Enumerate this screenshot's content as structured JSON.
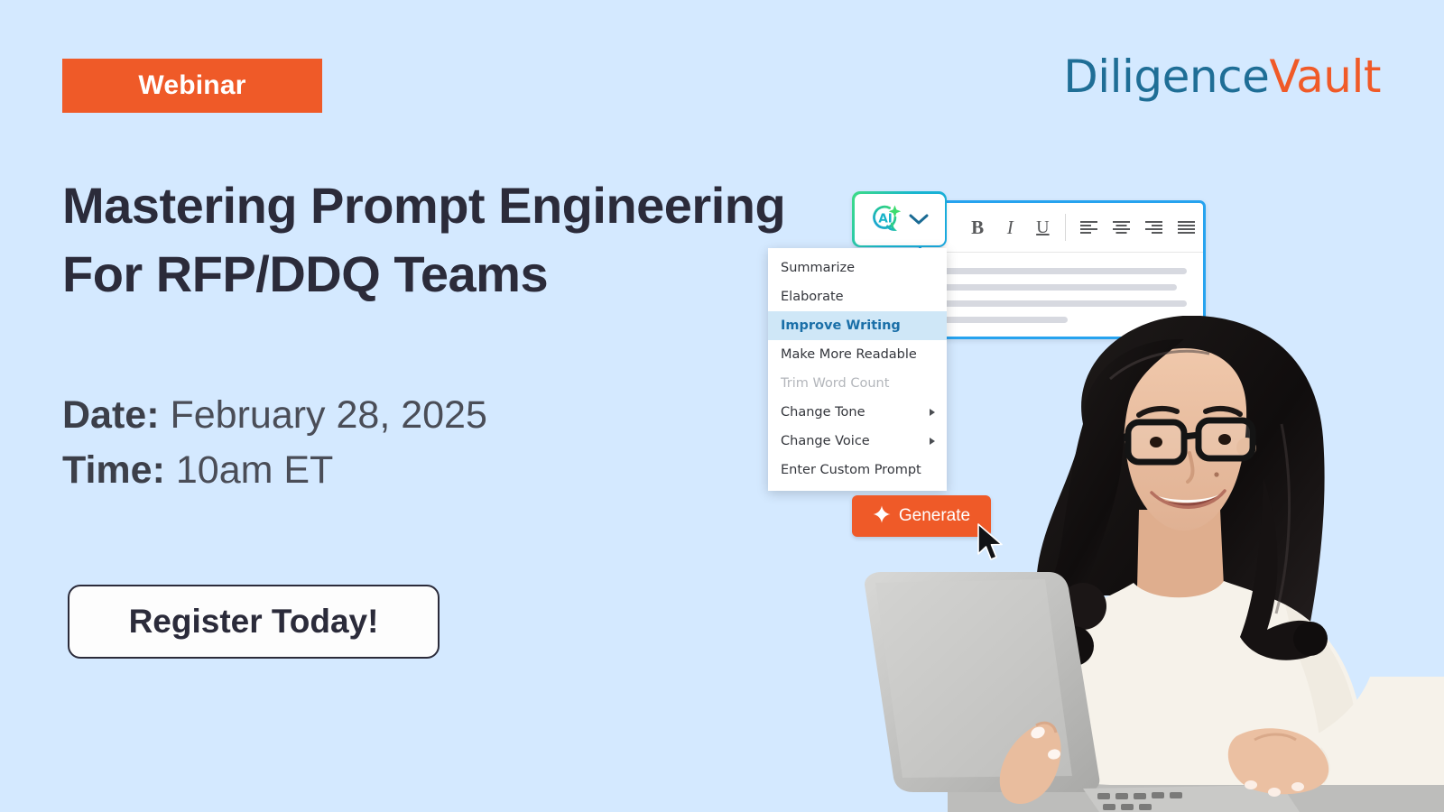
{
  "theme": {
    "background": "#d4e9ff",
    "accent_orange": "#ef5a28",
    "logo_blue": "#1f6e96",
    "logo_orange": "#f05a28",
    "heading_color": "#2b2b3a",
    "editor_border_blue": "#27a3ef",
    "menu_highlight_bg": "#cfe7f7",
    "menu_highlight_text": "#1a6fa8"
  },
  "badge": {
    "label": "Webinar"
  },
  "logo": {
    "part_one": "Diligence",
    "part_two": "Vault"
  },
  "headline": {
    "line1": "Mastering Prompt Engineering",
    "line2": "For RFP/DDQ Teams"
  },
  "details": [
    {
      "label": "Date:",
      "value": "February 28, 2025"
    },
    {
      "label": "Time:",
      "value": "10am ET"
    }
  ],
  "cta": {
    "label": "Register Today!"
  },
  "editor": {
    "ai_button": {
      "icon": "ai-sparkle-icon",
      "chevron": "chevron-down-icon"
    },
    "toolbar": [
      {
        "name": "bold-button",
        "glyph": "B"
      },
      {
        "name": "italic-button",
        "glyph": "I"
      },
      {
        "name": "underline-button",
        "glyph": "U"
      },
      {
        "name": "align-left-button",
        "glyph": ""
      },
      {
        "name": "align-center-button",
        "glyph": ""
      },
      {
        "name": "align-right-button",
        "glyph": ""
      },
      {
        "name": "align-justify-button",
        "glyph": ""
      }
    ],
    "text_line_widths": [
      "100%",
      "96%",
      "100%",
      "52%"
    ]
  },
  "ai_menu": {
    "items": [
      {
        "label": "Summarize",
        "state": "normal",
        "submenu": false
      },
      {
        "label": "Elaborate",
        "state": "normal",
        "submenu": false
      },
      {
        "label": "Improve Writing",
        "state": "active",
        "submenu": false
      },
      {
        "label": "Make More Readable",
        "state": "normal",
        "submenu": false
      },
      {
        "label": "Trim Word Count",
        "state": "disabled",
        "submenu": false
      },
      {
        "label": "Change Tone",
        "state": "normal",
        "submenu": true
      },
      {
        "label": "Change Voice",
        "state": "normal",
        "submenu": true
      },
      {
        "label": "Enter Custom Prompt",
        "state": "normal",
        "submenu": false
      }
    ]
  },
  "generate_button": {
    "label": "Generate",
    "icon": "sparkle-icon"
  },
  "photo": {
    "alt": "woman-with-glasses-typing-on-laptop"
  }
}
